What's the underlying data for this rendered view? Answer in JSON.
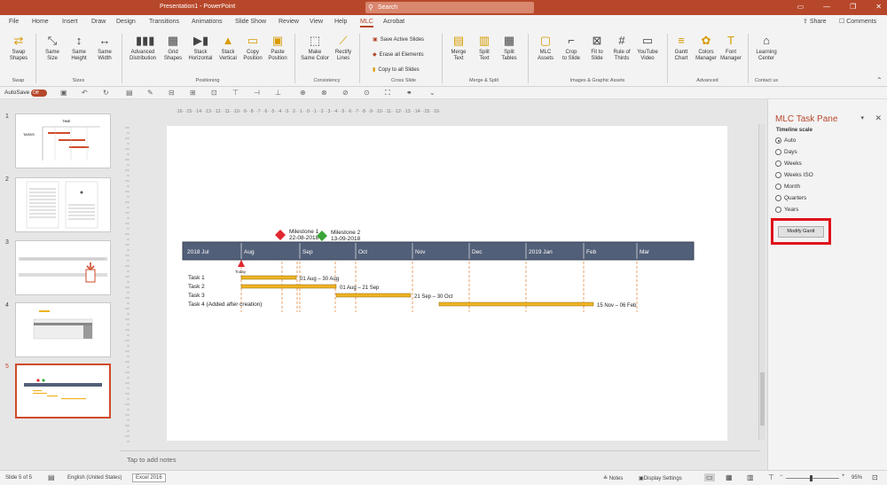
{
  "window": {
    "title": "Presentation1  -  PowerPoint",
    "search_placeholder": "Search",
    "controls": [
      "▭",
      "—",
      "❐",
      "✕"
    ]
  },
  "tabs": [
    "File",
    "Home",
    "Insert",
    "Draw",
    "Design",
    "Transitions",
    "Animations",
    "Slide Show",
    "Review",
    "View",
    "Help",
    "MLC",
    "Acrobat"
  ],
  "active_tab": "MLC",
  "share": "Share",
  "comments": "Comments",
  "ribbon": {
    "swap": {
      "label": "Swap\nShapes",
      "group": "Swap"
    },
    "sizes": [
      {
        "label": "Same\nSize"
      },
      {
        "label": "Same\nHeight"
      },
      {
        "label": "Same\nWidth"
      }
    ],
    "sizes_group": "Sizes",
    "positioning": [
      {
        "label": "Advanced\nDistribution"
      },
      {
        "label": "Grid\nShapes"
      },
      {
        "label": "Stack\nHorizontal"
      },
      {
        "label": "Stack\nVertical"
      },
      {
        "label": "Copy\nPosition"
      },
      {
        "label": "Paste\nPosition"
      }
    ],
    "positioning_group": "Positioning",
    "consistency": [
      {
        "label": "Make\nSame Color"
      },
      {
        "label": "Rectify\nLines"
      }
    ],
    "consistency_group": "Consistency",
    "cross_slide": [
      "Save Active Slides",
      "Erase all Elements",
      "Copy to all Slides"
    ],
    "cross_slide_group": "Cross Slide",
    "merge": [
      {
        "label": "Merge\nText"
      },
      {
        "label": "Split\nText"
      },
      {
        "label": "Split\nTables"
      }
    ],
    "merge_group": "Merge & Split",
    "images": [
      {
        "label": "MLC\nAssets"
      },
      {
        "label": "Crop\nto Slide"
      },
      {
        "label": "Fit to\nSlide"
      },
      {
        "label": "Rule of\nThirds"
      },
      {
        "label": "YouTube\nVideo"
      }
    ],
    "images_group": "Images & Graphic Assets",
    "advanced": [
      {
        "label": "Gantt\nChart"
      },
      {
        "label": "Colors\nManager"
      },
      {
        "label": "Font\nManager"
      }
    ],
    "advanced_group": "Advanced",
    "learning": {
      "label": "Learning\nCenter"
    },
    "contact_group": "Contact us"
  },
  "qat": {
    "autosave": "AutoSave",
    "toggle": "Off"
  },
  "slides": {
    "numbers": [
      "1",
      "2",
      "3",
      "4",
      "5"
    ],
    "selected": 5
  },
  "ruler_ticks": "·16· ·15· ·14· ·13· ·12· ·11· ·10· ·9· ·8· ·7· ·6· ·5· ·4· ·3· ·2· ·1· ·0· ·1· ·2· ·3· ·4· ·5· ·6· ·7· ·8· ·9· ·10· ·11· ·12· ·13· ·14· ·15· ·16·",
  "gantt": {
    "milestones": [
      {
        "name": "Milestone 1",
        "date": "22-08-2018",
        "color": "#e0282e"
      },
      {
        "name": "Milestone 2",
        "date": "13-09-2018",
        "color": "#3aa53a"
      }
    ],
    "months": [
      "2018 Jul",
      "Aug",
      "Sep",
      "Oct",
      "Nov",
      "Dec",
      "2019 Jan",
      "Feb",
      "Mar"
    ],
    "today": "Today",
    "tasks": [
      {
        "name": "Task 1",
        "range": "01 Aug – 30 Aug"
      },
      {
        "name": "Task 2",
        "range": "01 Aug – 21 Sep"
      },
      {
        "name": "Task 3",
        "range": "21 Sep – 30 Oct"
      },
      {
        "name": "Task 4 (Added after creation)",
        "range": "15 Nov – 06 Feb"
      }
    ],
    "bar_color": "#f0b323",
    "header_color": "#525f78"
  },
  "notes_placeholder": "Tap to add notes",
  "pane": {
    "title": "MLC Task Pane",
    "scale_label": "Timeline scale",
    "options": [
      "Auto",
      "Days",
      "Weeks",
      "Weeks ISO",
      "Month",
      "Quarters",
      "Years"
    ],
    "selected": "Auto",
    "modify_button": "Modify Gantt"
  },
  "status": {
    "slide": "Slide 5 of 5",
    "language": "English (United States)",
    "excel": "Excel 2016",
    "notes": "Notes",
    "display": "Display Settings",
    "zoom": "95%"
  }
}
